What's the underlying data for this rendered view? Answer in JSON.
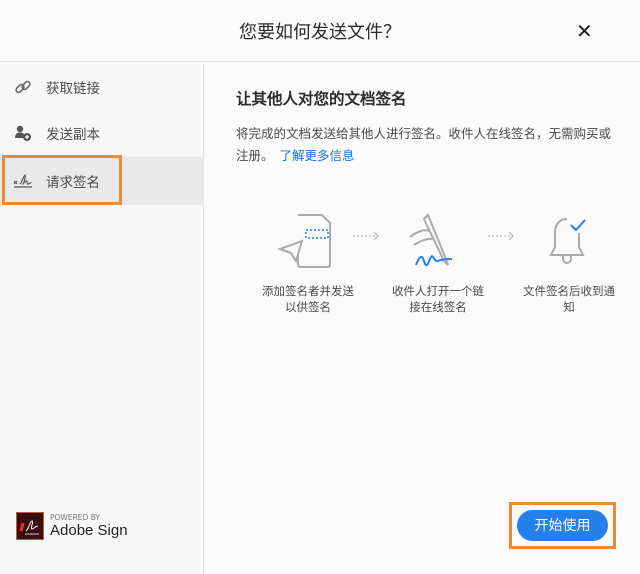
{
  "dialog": {
    "title": "您要如何发送文件？",
    "close_label": "✕"
  },
  "sidebar": {
    "items": [
      {
        "label": "获取链接",
        "icon": "link-icon"
      },
      {
        "label": "发送副本",
        "icon": "add-user-icon"
      },
      {
        "label": "请求签名",
        "icon": "signature-icon",
        "selected": true
      }
    ]
  },
  "main": {
    "heading": "让其他人对您的文档签名",
    "description": "将完成的文档发送给其他人进行签名。收件人在线签名，无需购买或注册。",
    "learn_more": "了解更多信息",
    "steps": [
      {
        "line1": "添加签名者并发送",
        "line2": "以供签名"
      },
      {
        "line1": "收件人打开一个链",
        "line2": "接在线签名"
      },
      {
        "line1": "文件签名后收到通",
        "line2": "知"
      }
    ]
  },
  "footer": {
    "powered_by": "POWERED BY",
    "brand": "Adobe Sign",
    "start_button": "开始使用"
  },
  "colors": {
    "accent": "#2680eb",
    "highlight": "#f08a30"
  }
}
